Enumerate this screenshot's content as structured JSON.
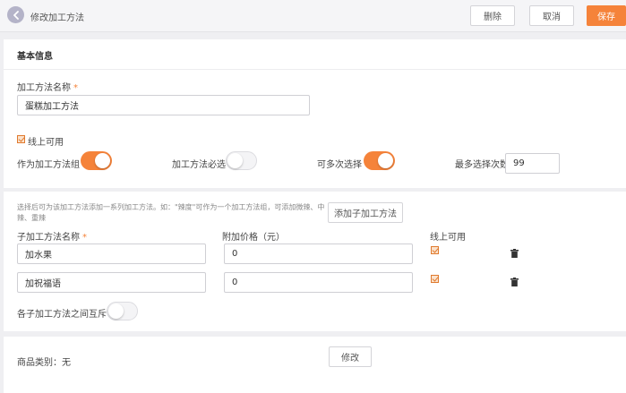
{
  "header": {
    "title": "修改加工方法",
    "delete_label": "删除",
    "cancel_label": "取消",
    "save_label": "保存"
  },
  "basic": {
    "section_title": "基本信息",
    "name_label": "加工方法名称",
    "required_mark": "*",
    "name_value": "蛋糕加工方法",
    "online_label": "线上可用",
    "online_checked": true,
    "as_group_label": "作为加工方法组",
    "as_group_on": true,
    "required_select_label": "加工方法必选",
    "required_select_on": false,
    "multi_select_label": "可多次选择",
    "multi_select_on": true,
    "max_select_label": "最多选择次数",
    "max_select_value": "99"
  },
  "sub": {
    "hint": "选择后可为该加工方法添加一系列加工方法。如：\"辣度\"可作为一个加工方法组，可添加微辣、中辣、重辣",
    "add_button_label": "添加子加工方法",
    "col_name": "子加工方法名称",
    "col_price": "附加价格（元）",
    "col_online": "线上可用",
    "rows": [
      {
        "name": "加水果",
        "price": "0",
        "online": true
      },
      {
        "name": "加祝福语",
        "price": "0",
        "online": true
      }
    ],
    "exclusive_label": "各子加工方法之间互斥",
    "exclusive_on": false
  },
  "category": {
    "label": "商品类别：无",
    "edit_button_label": "修改"
  },
  "colors": {
    "accent": "#f5833a",
    "back_button": "#b4b3c8",
    "background": "#efeff2"
  }
}
